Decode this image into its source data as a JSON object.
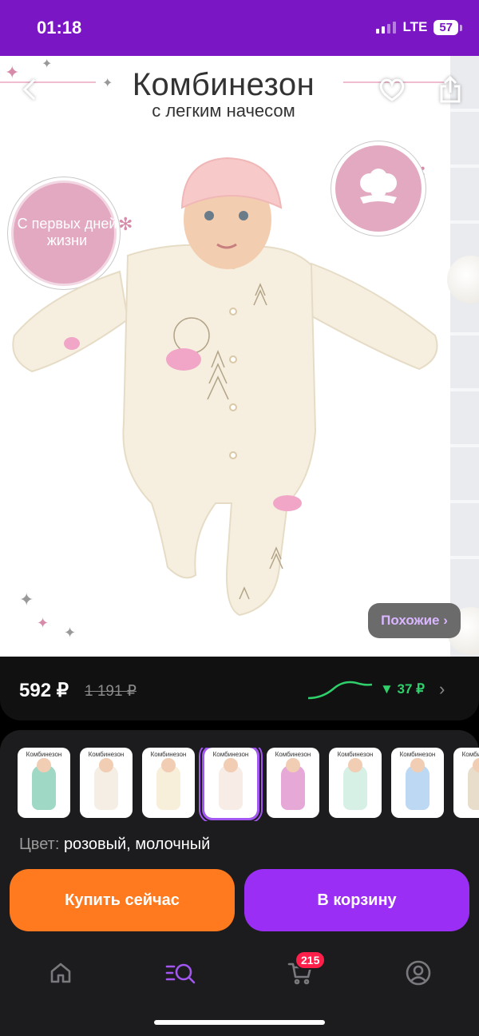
{
  "status": {
    "time": "01:18",
    "network": "LTE",
    "battery": "57"
  },
  "hero": {
    "title": "Комбинезон",
    "subtitle": "с легким начесом",
    "badge_left": "С первых дней жизни",
    "similar_label": "Похожие ›"
  },
  "price": {
    "current": "592 ₽",
    "old": "1 191 ₽",
    "drop": "▼ 37 ₽",
    "chevron": "›",
    "trend_color": "#2fd06b"
  },
  "options": {
    "thumbnail_title": "Комбинезон",
    "thumbnails": [
      {
        "color": "#9fd8c4"
      },
      {
        "color": "#f4eee4"
      },
      {
        "color": "#f7efd9"
      },
      {
        "color": "#f7ece6",
        "selected": true
      },
      {
        "color": "#e6a8d6"
      },
      {
        "color": "#d7f0e6"
      },
      {
        "color": "#bcd8f2"
      },
      {
        "color": "#e8ddcb"
      }
    ],
    "color_label": "Цвет:",
    "color_value": "розовый, молочный"
  },
  "actions": {
    "buy_now": "Купить сейчас",
    "add_to_cart": "В корзину"
  },
  "tabbar": {
    "items": [
      "home-icon",
      "catalog-search-icon",
      "cart-icon",
      "profile-icon"
    ],
    "cart_count": "215",
    "accent": "#a157f0"
  },
  "colors": {
    "status_bar": "#7a16c4",
    "buy": "#ff7a1f",
    "cart": "#9b2ef4",
    "badge": "#ff1f4b"
  }
}
